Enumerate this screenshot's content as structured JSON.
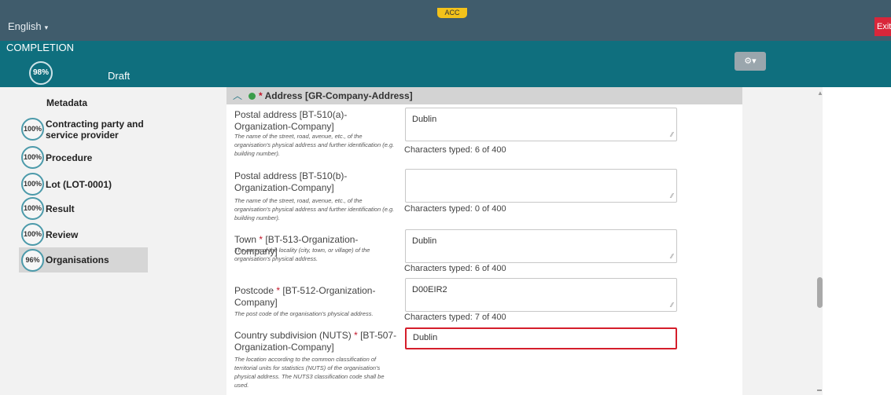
{
  "header": {
    "language": "English",
    "environment_badge": "ACC",
    "exit_label": "Exit"
  },
  "completion": {
    "title": "COMPLETION",
    "percent": "98%",
    "status": "Draft"
  },
  "sidebar": {
    "items": [
      {
        "label": "Metadata",
        "percent": ""
      },
      {
        "label": "Contracting party and service provider",
        "percent": "100%"
      },
      {
        "label": "Procedure",
        "percent": "100%"
      },
      {
        "label": "Lot (LOT-0001)",
        "percent": "100%"
      },
      {
        "label": "Result",
        "percent": "100%"
      },
      {
        "label": "Review",
        "percent": "100%"
      },
      {
        "label": "Organisations",
        "percent": "96%"
      }
    ]
  },
  "section": {
    "title": "Address",
    "code": "[GR-Company-Address]"
  },
  "fields": [
    {
      "label": "Postal address [BT-510(a)-Organization-Company]",
      "required": "",
      "help": "The name of the street, road, avenue, etc., of the organisation's physical address and further identification (e.g. building number).",
      "value": "Dublin",
      "counter": "Characters typed: 6 of 400"
    },
    {
      "label": "Postal address [BT-510(b)-Organization-Company]",
      "required": "",
      "help": "The name of the street, road, avenue, etc., of the organisation's physical address and further identification (e.g. building number).",
      "value": "",
      "counter": "Characters typed: 0 of 400"
    },
    {
      "label_a": "Town",
      "label_b": "[BT-513-Organization-Company]",
      "required": "*",
      "help": "The name of the locality (city, town, or village) of the organisation's physical address.",
      "value": "Dublin",
      "counter": "Characters typed: 6 of 400"
    },
    {
      "label_a": "Postcode",
      "label_b": "[BT-512-Organization-Company]",
      "required": "*",
      "help": "The post code of the organisation's physical address.",
      "value": "D00EIR2",
      "counter": "Characters typed: 7 of 400"
    },
    {
      "label_a": "Country subdivision (NUTS)",
      "label_b": "[BT-507-Organization-Company]",
      "required": "*",
      "help": "The location according to the common classification of territorial units for statistics (NUTS) of the organisation's physical address. The NUTS3 classification code shall be used.",
      "value": "Dublin"
    }
  ],
  "icons": {
    "lang_caret": "▾",
    "chevron_up": "︿",
    "resize": "⁄⁄",
    "scroll_up": "▲",
    "tools": "⚙▾"
  },
  "colors": {
    "header_bg": "#405c6c",
    "band_bg": "#0f6f7e",
    "env_badge": "#f3c21a",
    "exit": "#d9263a",
    "error_border": "#d51e2b"
  }
}
